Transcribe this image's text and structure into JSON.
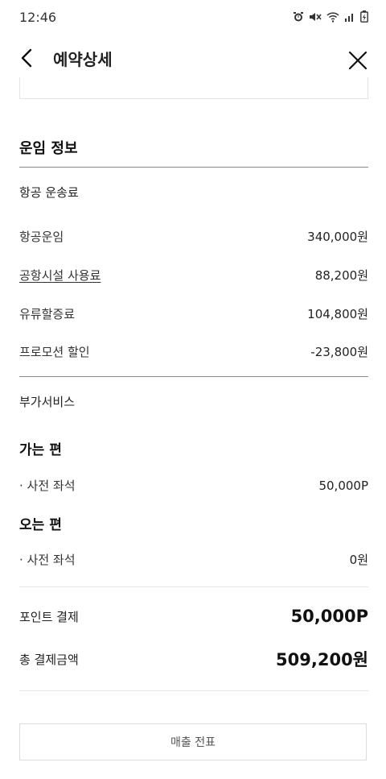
{
  "status_bar": {
    "time": "12:46",
    "icons": [
      "alarm-icon",
      "mute-icon",
      "wifi-icon",
      "signal-icon",
      "battery-icon"
    ]
  },
  "header": {
    "title": "예약상세",
    "back_icon": "chevron-left-icon",
    "close_icon": "close-icon"
  },
  "fare_info": {
    "section_title": "운임 정보",
    "air_transport_label": "항공 운송료",
    "rows": [
      {
        "label": "항공운임",
        "value": "340,000원"
      },
      {
        "label": "공항시설 사용료",
        "value": "88,200원"
      },
      {
        "label": "유류할증료",
        "value": "104,800원"
      },
      {
        "label": "프로모션 할인",
        "value": "-23,800원"
      }
    ]
  },
  "extras": {
    "label": "부가서비스",
    "outbound": {
      "title": "가는 편",
      "item_label": "· 사전 좌석",
      "item_value": "50,000P"
    },
    "inbound": {
      "title": "오는 편",
      "item_label": "· 사전 좌석",
      "item_value": "0원"
    }
  },
  "payment": {
    "points_label": "포인트 결제",
    "points_value": "50,000P",
    "total_label": "총 결제금액",
    "total_value": "509,200원"
  },
  "receipt_button": "매출 전표",
  "colors": {
    "text": "#222222",
    "divider": "#8a8a8a",
    "light_divider": "#e5e5e5"
  }
}
